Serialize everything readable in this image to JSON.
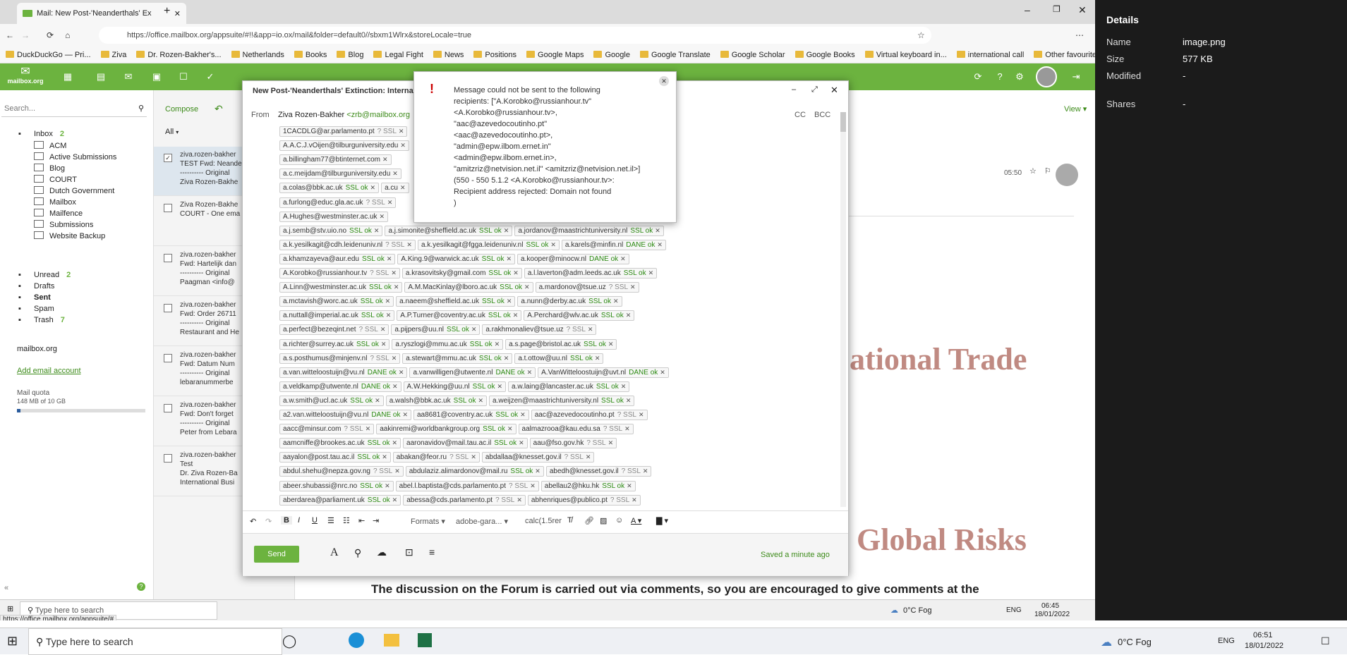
{
  "browser": {
    "tab_title": "Mail: New Post-'Neanderthals' Ex",
    "url": "https://office.mailbox.org/appsuite/#!!&app=io.ox/mail&folder=default0//sbxm1Wlrx&storeLocale=true",
    "bookmarks": [
      "DuckDuckGo — Pri...",
      "Ziva",
      "Dr. Rozen-Bakher's...",
      "Netherlands",
      "Books",
      "Blog",
      "Legal Fight",
      "News",
      "Positions",
      "Google Maps",
      "Google",
      "Google Translate",
      "Google Scholar",
      "Google Books",
      "Virtual keyboard in...",
      "international call",
      "Other favourites"
    ],
    "status_url": "https://office.mailbox.org/appsuite/#"
  },
  "app": {
    "logo": "mailbox.org",
    "search_placeholder": "Search...",
    "compose_label": "Compose",
    "filter_label": "All",
    "view_label": "View"
  },
  "folders": [
    {
      "label": "Inbox",
      "count": "2"
    },
    {
      "label": "ACM"
    },
    {
      "label": "Active Submissions"
    },
    {
      "label": "Blog"
    },
    {
      "label": "COURT"
    },
    {
      "label": "Dutch Government"
    },
    {
      "label": "Mailbox"
    },
    {
      "label": "Mailfence"
    },
    {
      "label": "Submissions"
    },
    {
      "label": "Website Backup"
    },
    {
      "label": "Unread",
      "count": "2"
    },
    {
      "label": "Drafts"
    },
    {
      "label": "Sent"
    },
    {
      "label": "Spam"
    },
    {
      "label": "Trash",
      "count": "7"
    }
  ],
  "account": {
    "name": "mailbox.org",
    "add_link": "Add email account",
    "quota_label": "Mail quota",
    "quota_value": "148 MB of 10 GB",
    "quota_fraction": 0.015
  },
  "mail_list": [
    {
      "line1": "ziva.rozen-bakher",
      "line2": "TEST Fwd: Neande",
      "line3": "---------- Original",
      "line4": "Ziva Rozen-Bakhe"
    },
    {
      "line1": "Ziva Rozen-Bakhe",
      "line2": "COURT - One ema",
      "line3": "",
      "line4": ""
    },
    {
      "line1": "ziva.rozen-bakher",
      "line2": "Fwd: Hartelijk dan",
      "line3": "---------- Original",
      "line4": "Paagman <info@"
    },
    {
      "line1": "ziva.rozen-bakher",
      "line2": "Fwd: Order 26711",
      "line3": "---------- Original",
      "line4": "Restaurant and He"
    },
    {
      "line1": "ziva.rozen-bakher",
      "line2": "Fwd: Datum Num",
      "line3": "---------- Original",
      "line4": "lebaranummerbe"
    },
    {
      "line1": "ziva.rozen-bakher",
      "line2": "Fwd: Don't forget",
      "line3": "---------- Original",
      "line4": "Peter from Lebara"
    },
    {
      "line1": "ziva.rozen-bakher",
      "line2": "Test",
      "line3": "Dr. Ziva Rozen-Ba",
      "line4": "International Busi"
    }
  ],
  "reading": {
    "time": "05:50",
    "heading1": "ational Trade",
    "heading2": "Global Risks",
    "body": "The discussion on the Forum is carried out via comments, so you are encouraged to give comments at the"
  },
  "compose": {
    "title": "New Post-'Neanderthals' Extinction: Internatio",
    "from_label": "From",
    "from_name": "Ziva Rozen-Bakher",
    "from_email": "<zrb@mailbox.org",
    "cc": "CC",
    "bcc": "BCC",
    "recipient_rows": [
      [
        {
          "e": "1CACDLG@ar.parlamento.pt",
          "s": "? SSL"
        }
      ],
      [
        {
          "e": "A.A.C.J.vOijen@tilburguniversity.edu",
          "s": ""
        }
      ],
      [
        {
          "e": "a.billingham77@btinternet.com",
          "s": ""
        }
      ],
      [
        {
          "e": "a.c.meijdam@tilburguniversity.edu",
          "s": ""
        }
      ],
      [
        {
          "e": "a.colas@bbk.ac.uk",
          "s": "SSL ok"
        },
        {
          "e": "a.cu",
          "s": ""
        }
      ],
      [
        {
          "e": "a.furlong@educ.gla.ac.uk",
          "s": "? SSL"
        }
      ],
      [
        {
          "e": "A.Hughes@westminster.ac.uk",
          "s": ""
        }
      ],
      [
        {
          "e": "a.j.semb@stv.uio.no",
          "s": "SSL ok"
        },
        {
          "e": "a.j.simonite@sheffield.ac.uk",
          "s": "SSL ok"
        },
        {
          "e": "a.jordanov@maastrichtuniversity.nl",
          "s": "SSL ok"
        }
      ],
      [
        {
          "e": "a.k.yesilkagit@cdh.leidenuniv.nl",
          "s": "? SSL"
        },
        {
          "e": "a.k.yesilkagit@fgga.leidenuniv.nl",
          "s": "SSL ok"
        },
        {
          "e": "a.karels@minfin.nl",
          "s": "DANE ok"
        }
      ],
      [
        {
          "e": "a.khamzayeva@aur.edu",
          "s": "SSL ok"
        },
        {
          "e": "A.King.9@warwick.ac.uk",
          "s": "SSL ok"
        },
        {
          "e": "a.kooper@minocw.nl",
          "s": "DANE ok"
        }
      ],
      [
        {
          "e": "A.Korobko@russianhour.tv",
          "s": "? SSL"
        },
        {
          "e": "a.krasovitsky@gmail.com",
          "s": "SSL ok"
        },
        {
          "e": "a.l.laverton@adm.leeds.ac.uk",
          "s": "SSL ok"
        }
      ],
      [
        {
          "e": "A.Linn@westminster.ac.uk",
          "s": "SSL ok"
        },
        {
          "e": "A.M.MacKinlay@lboro.ac.uk",
          "s": "SSL ok"
        },
        {
          "e": "a.mardonov@tsue.uz",
          "s": "? SSL"
        }
      ],
      [
        {
          "e": "a.mctavish@worc.ac.uk",
          "s": "SSL ok"
        },
        {
          "e": "a.naeem@sheffield.ac.uk",
          "s": "SSL ok"
        },
        {
          "e": "a.nunn@derby.ac.uk",
          "s": "SSL ok"
        }
      ],
      [
        {
          "e": "a.nuttall@imperial.ac.uk",
          "s": "SSL ok"
        },
        {
          "e": "A.P.Turner@coventry.ac.uk",
          "s": "SSL ok"
        },
        {
          "e": "A.Perchard@wlv.ac.uk",
          "s": "SSL ok"
        }
      ],
      [
        {
          "e": "a.perfect@bezeqint.net",
          "s": "? SSL"
        },
        {
          "e": "a.pijpers@uu.nl",
          "s": "SSL ok"
        },
        {
          "e": "a.rakhmonaliev@tsue.uz",
          "s": "? SSL"
        }
      ],
      [
        {
          "e": "a.richter@surrey.ac.uk",
          "s": "SSL ok"
        },
        {
          "e": "a.ryszlogi@mmu.ac.uk",
          "s": "SSL ok"
        },
        {
          "e": "a.s.page@bristol.ac.uk",
          "s": "SSL ok"
        }
      ],
      [
        {
          "e": "a.s.posthumus@minjenv.nl",
          "s": "? SSL"
        },
        {
          "e": "a.stewart@mmu.ac.uk",
          "s": "SSL ok"
        },
        {
          "e": "a.t.ottow@uu.nl",
          "s": "SSL ok"
        }
      ],
      [
        {
          "e": "a.van.witteloostuijn@vu.nl",
          "s": "DANE ok"
        },
        {
          "e": "a.vanwilligen@utwente.nl",
          "s": "DANE ok"
        },
        {
          "e": "A.VanWitteloostuijn@uvt.nl",
          "s": "DANE ok"
        }
      ],
      [
        {
          "e": "a.veldkamp@utwente.nl",
          "s": "DANE ok"
        },
        {
          "e": "A.W.Hekking@uu.nl",
          "s": "SSL ok"
        },
        {
          "e": "a.w.laing@lancaster.ac.uk",
          "s": "SSL ok"
        }
      ],
      [
        {
          "e": "a.w.smith@ucl.ac.uk",
          "s": "SSL ok"
        },
        {
          "e": "a.walsh@bbk.ac.uk",
          "s": "SSL ok"
        },
        {
          "e": "a.weijzen@maastrichtuniversity.nl",
          "s": "SSL ok"
        }
      ],
      [
        {
          "e": "a2.van.witteloostuijn@vu.nl",
          "s": "DANE ok"
        },
        {
          "e": "aa8681@coventry.ac.uk",
          "s": "SSL ok"
        },
        {
          "e": "aac@azevedocoutinho.pt",
          "s": "? SSL"
        }
      ],
      [
        {
          "e": "aacc@minsur.com",
          "s": "? SSL"
        },
        {
          "e": "aakinremi@worldbankgroup.org",
          "s": "SSL ok"
        },
        {
          "e": "aalmazrooa@kau.edu.sa",
          "s": "? SSL"
        }
      ],
      [
        {
          "e": "aamcniffe@brookes.ac.uk",
          "s": "SSL ok"
        },
        {
          "e": "aaronavidov@mail.tau.ac.il",
          "s": "SSL ok"
        },
        {
          "e": "aau@fso.gov.hk",
          "s": "? SSL"
        }
      ],
      [
        {
          "e": "aayalon@post.tau.ac.il",
          "s": "SSL ok"
        },
        {
          "e": "abakan@feor.ru",
          "s": "? SSL"
        },
        {
          "e": "abdallaa@knesset.gov.il",
          "s": "? SSL"
        }
      ],
      [
        {
          "e": "abdul.shehu@nepza.gov.ng",
          "s": "? SSL"
        },
        {
          "e": "abdulaziz.alimardonov@mail.ru",
          "s": "SSL ok"
        },
        {
          "e": "abedh@knesset.gov.il",
          "s": "? SSL"
        }
      ],
      [
        {
          "e": "abeer.shubassi@nrc.no",
          "s": "SSL ok"
        },
        {
          "e": "abel.l.baptista@cds.parlamento.pt",
          "s": "? SSL"
        },
        {
          "e": "abellau2@hku.hk",
          "s": "SSL ok"
        }
      ],
      [
        {
          "e": "aberdarea@parliament.uk",
          "s": "SSL ok"
        },
        {
          "e": "abessa@cds.parlamento.pt",
          "s": "? SSL"
        },
        {
          "e": "abhenriques@publico.pt",
          "s": "? SSL"
        }
      ]
    ],
    "formats_label": "Formats",
    "font_label": "adobe-gara...",
    "size_label": "calc(1.5rer",
    "send_label": "Send",
    "saved_label": "Saved a minute ago"
  },
  "dialog": {
    "lines": [
      "Message could not be sent to the following",
      "recipients: [\"A.Korobko@russianhour.tv\"",
      "<A.Korobko@russianhour.tv>,",
      "\"aac@azevedocoutinho.pt\"",
      "<aac@azevedocoutinho.pt>,",
      "\"admin@epw.ilbom.ernet.in\"",
      "<admin@epw.ilbom.ernet.in>,",
      "\"amitzriz@netvision.net.il\" <amitzriz@netvision.net.il>]",
      "(550 - 550 5.1.2 <A.Korobko@russianhour.tv>:",
      "Recipient address rejected: Domain not found",
      ")"
    ]
  },
  "details_panel": {
    "title": "Details",
    "rows": [
      {
        "label": "Name",
        "value": "image.png"
      },
      {
        "label": "Size",
        "value": "577 KB"
      },
      {
        "label": "Modified",
        "value": "-"
      },
      {
        "label": "Shares",
        "value": "-"
      }
    ]
  },
  "taskbar_inner": {
    "search": "Type here to search",
    "weather": "0°C  Fog",
    "lang": "ENG",
    "time": "06:45",
    "date": "18/01/2022"
  },
  "taskbar_outer": {
    "search": "Type here to search",
    "weather": "0°C  Fog",
    "lang": "ENG",
    "time": "06:51",
    "date": "18/01/2022"
  },
  "colors": {
    "accent": "#6cb33f",
    "ok_green": "#2c8a12",
    "error_red": "#cc0000"
  }
}
